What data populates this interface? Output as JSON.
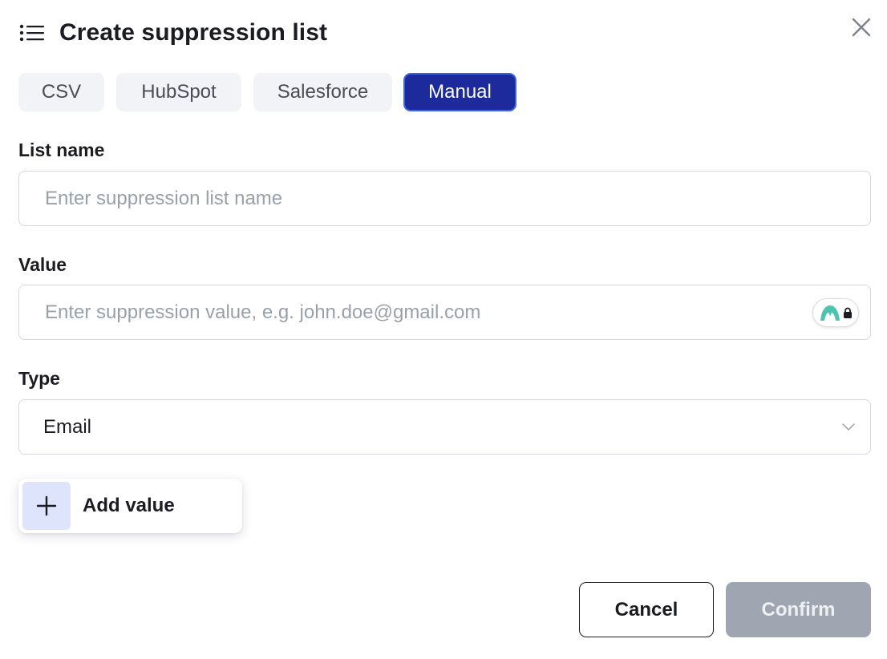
{
  "header": {
    "title": "Create suppression list",
    "menu_icon": "list-icon",
    "close_icon": "close-icon"
  },
  "tabs": [
    {
      "label": "CSV",
      "selected": false
    },
    {
      "label": "HubSpot",
      "selected": false
    },
    {
      "label": "Salesforce",
      "selected": false
    },
    {
      "label": "Manual",
      "selected": true
    }
  ],
  "form": {
    "list_name": {
      "label": "List name",
      "placeholder": "Enter suppression list name",
      "value": ""
    },
    "value": {
      "label": "Value",
      "placeholder": "Enter suppression value, e.g. john.doe@gmail.com",
      "value": "",
      "extension_badge_icon": "password-manager-lock-icon"
    },
    "type": {
      "label": "Type",
      "selected": "Email",
      "chevron_icon": "chevron-down-icon"
    }
  },
  "add_value": {
    "label": "Add value",
    "icon": "plus-icon"
  },
  "footer": {
    "cancel_label": "Cancel",
    "confirm_label": "Confirm",
    "confirm_disabled": true
  },
  "colors": {
    "tab_selected_bg": "#1c2a9b",
    "tab_selected_border": "#3f63e3",
    "tab_bg": "#f2f3f7",
    "confirm_disabled_bg": "#a0a6b1",
    "add_icon_bg": "#dde4fb",
    "text_primary": "#1b1c22",
    "placeholder": "#9aa0aa"
  }
}
